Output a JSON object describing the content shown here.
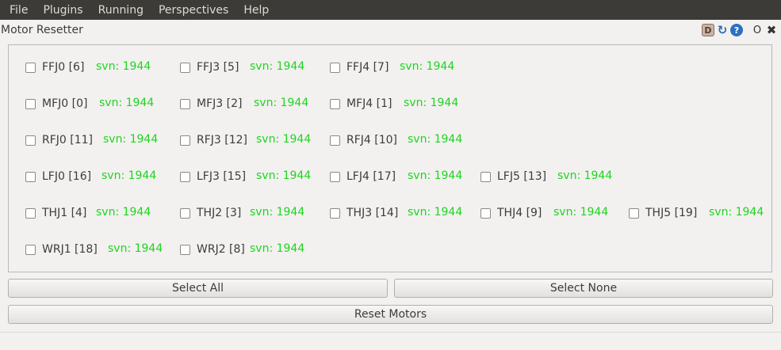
{
  "menubar": {
    "items": [
      "File",
      "Plugins",
      "Running",
      "Perspectives",
      "Help"
    ]
  },
  "plugin": {
    "title": "Motor Resetter",
    "icons": [
      "debug-icon",
      "reload-icon",
      "help-icon",
      "float-icon",
      "close-icon"
    ]
  },
  "motors": {
    "svn_color": "#1ed51e",
    "rows": [
      [
        {
          "name": "FFJ0 [6]",
          "svn": "svn: 1944"
        },
        {
          "name": "FFJ3 [5]",
          "svn": "svn: 1944"
        },
        {
          "name": "FFJ4 [7]",
          "svn": "svn: 1944"
        }
      ],
      [
        {
          "name": "MFJ0 [0]",
          "svn": "svn: 1944"
        },
        {
          "name": "MFJ3 [2]",
          "svn": "svn: 1944"
        },
        {
          "name": "MFJ4 [1]",
          "svn": "svn: 1944"
        }
      ],
      [
        {
          "name": "RFJ0 [11]",
          "svn": "svn: 1944"
        },
        {
          "name": "RFJ3 [12]",
          "svn": "svn: 1944"
        },
        {
          "name": "RFJ4 [10]",
          "svn": "svn: 1944"
        }
      ],
      [
        {
          "name": "LFJ0 [16]",
          "svn": "svn: 1944"
        },
        {
          "name": "LFJ3 [15]",
          "svn": "svn: 1944"
        },
        {
          "name": "LFJ4 [17]",
          "svn": "svn: 1944"
        },
        {
          "name": "LFJ5 [13]",
          "svn": "svn: 1944"
        }
      ],
      [
        {
          "name": "THJ1 [4]",
          "svn": "svn: 1944"
        },
        {
          "name": "THJ2 [3]",
          "svn": "svn: 1944"
        },
        {
          "name": "THJ3 [14]",
          "svn": "svn: 1944"
        },
        {
          "name": "THJ4 [9]",
          "svn": "svn: 1944"
        },
        {
          "name": "THJ5 [19]",
          "svn": "svn: 1944"
        }
      ],
      [
        {
          "name": "WRJ1 [18]",
          "svn": "svn: 1944"
        },
        {
          "name": "WRJ2 [8]",
          "svn": "svn: 1944"
        }
      ]
    ]
  },
  "buttons": {
    "select_all": "Select All",
    "select_none": "Select None",
    "reset_motors": "Reset Motors"
  }
}
